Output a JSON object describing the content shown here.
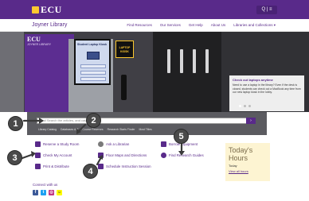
{
  "header": {
    "logo_text": "ECU",
    "search_label": "Q | ≡",
    "site_title": "Joyner Library",
    "nav": [
      "Find Resources",
      "Our Services",
      "Get Help",
      "About Us",
      "Libraries and Collections ▾"
    ]
  },
  "hero": {
    "kiosk_logo": "ECU",
    "kiosk_sub": "JOYNER LIBRARY",
    "screen_title": "Student Laptop Kiosk",
    "sticker_text": "LAPTOP\nKIOSK",
    "caption_title": "Check out laptops anytime",
    "caption_text": "Need to use a laptop in the library? Even if the desk is closed, students can check out a MacBook any time from our new laptop kiosk in the lobby.",
    "slide_count": 3,
    "active_slide": 1
  },
  "search": {
    "placeholder": "Find Search the articles, and catalog",
    "go_label": "›",
    "quick_links": [
      "Library Catalog",
      "Databases A-Z",
      "Course Reserves",
      "Research Starts Finder",
      "Most Titles"
    ]
  },
  "links": {
    "col1": [
      "Reserve a Study Room",
      "Check My Account",
      "Print & Distribute"
    ],
    "col2": [
      "Ask a Librarian",
      "Floor Maps and Directions",
      "Schedule Instruction Session"
    ],
    "col3": [
      "Borrow Equipment",
      "Find Research Guides"
    ]
  },
  "hours": {
    "title": "Today's Hours",
    "today": "Today",
    "view_all": "View all hours"
  },
  "connect": {
    "label": "Connect with us",
    "icons": [
      "facebook-icon",
      "twitter-icon",
      "instagram-icon",
      "snapchat-icon"
    ]
  },
  "badges": [
    "1",
    "2",
    "3",
    "4",
    "5"
  ],
  "colors": {
    "brand_purple": "#592a8a",
    "gold": "#fdc82f",
    "badge_gray": "#4a4a4a"
  }
}
